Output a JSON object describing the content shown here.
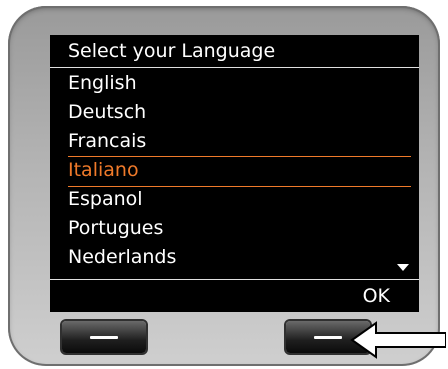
{
  "screen": {
    "title": "Select your Language",
    "languages": [
      "English",
      "Deutsch",
      "Francais",
      "Italiano",
      "Espanol",
      "Portugues",
      "Nederlands"
    ],
    "selected": "Italiano",
    "ok_label": "OK"
  },
  "colors": {
    "screen_bg": "#000000",
    "text": "#ffffff",
    "selection": "#f07a2a",
    "device_body": "#b4b4b4"
  },
  "icons": {
    "scroll": "scroll-down-icon",
    "pointer": "arrow-left-icon"
  }
}
